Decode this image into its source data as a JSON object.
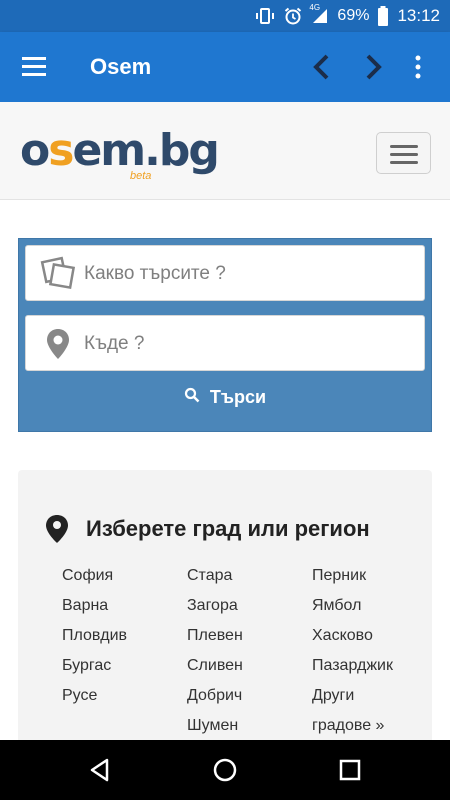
{
  "status_bar": {
    "network": "4G",
    "battery": "69%",
    "time": "13:12"
  },
  "app_bar": {
    "title": "Osem"
  },
  "site": {
    "logo_text": "osem.bg",
    "logo_badge": "beta"
  },
  "search": {
    "what_placeholder": "Какво търсите ?",
    "where_placeholder": "Къде ?",
    "button_label": "Търси"
  },
  "regions": {
    "title": "Изберете град или регион",
    "columns": [
      [
        "София",
        "Варна",
        "Пловдив",
        "Бургас",
        "Русе"
      ],
      [
        "Стара",
        "Загора",
        "Плевен",
        "Сливен",
        "Добрич",
        "Шумен"
      ],
      [
        "Перник",
        "Ямбол",
        "Хасково",
        "Пазарджик",
        "Други",
        "градове »"
      ]
    ]
  },
  "colors": {
    "app_bar": "#1f77d0",
    "status_bar": "#1e6ab8",
    "search_panel": "#4b86b9",
    "logo_accent": "#f0a021"
  }
}
